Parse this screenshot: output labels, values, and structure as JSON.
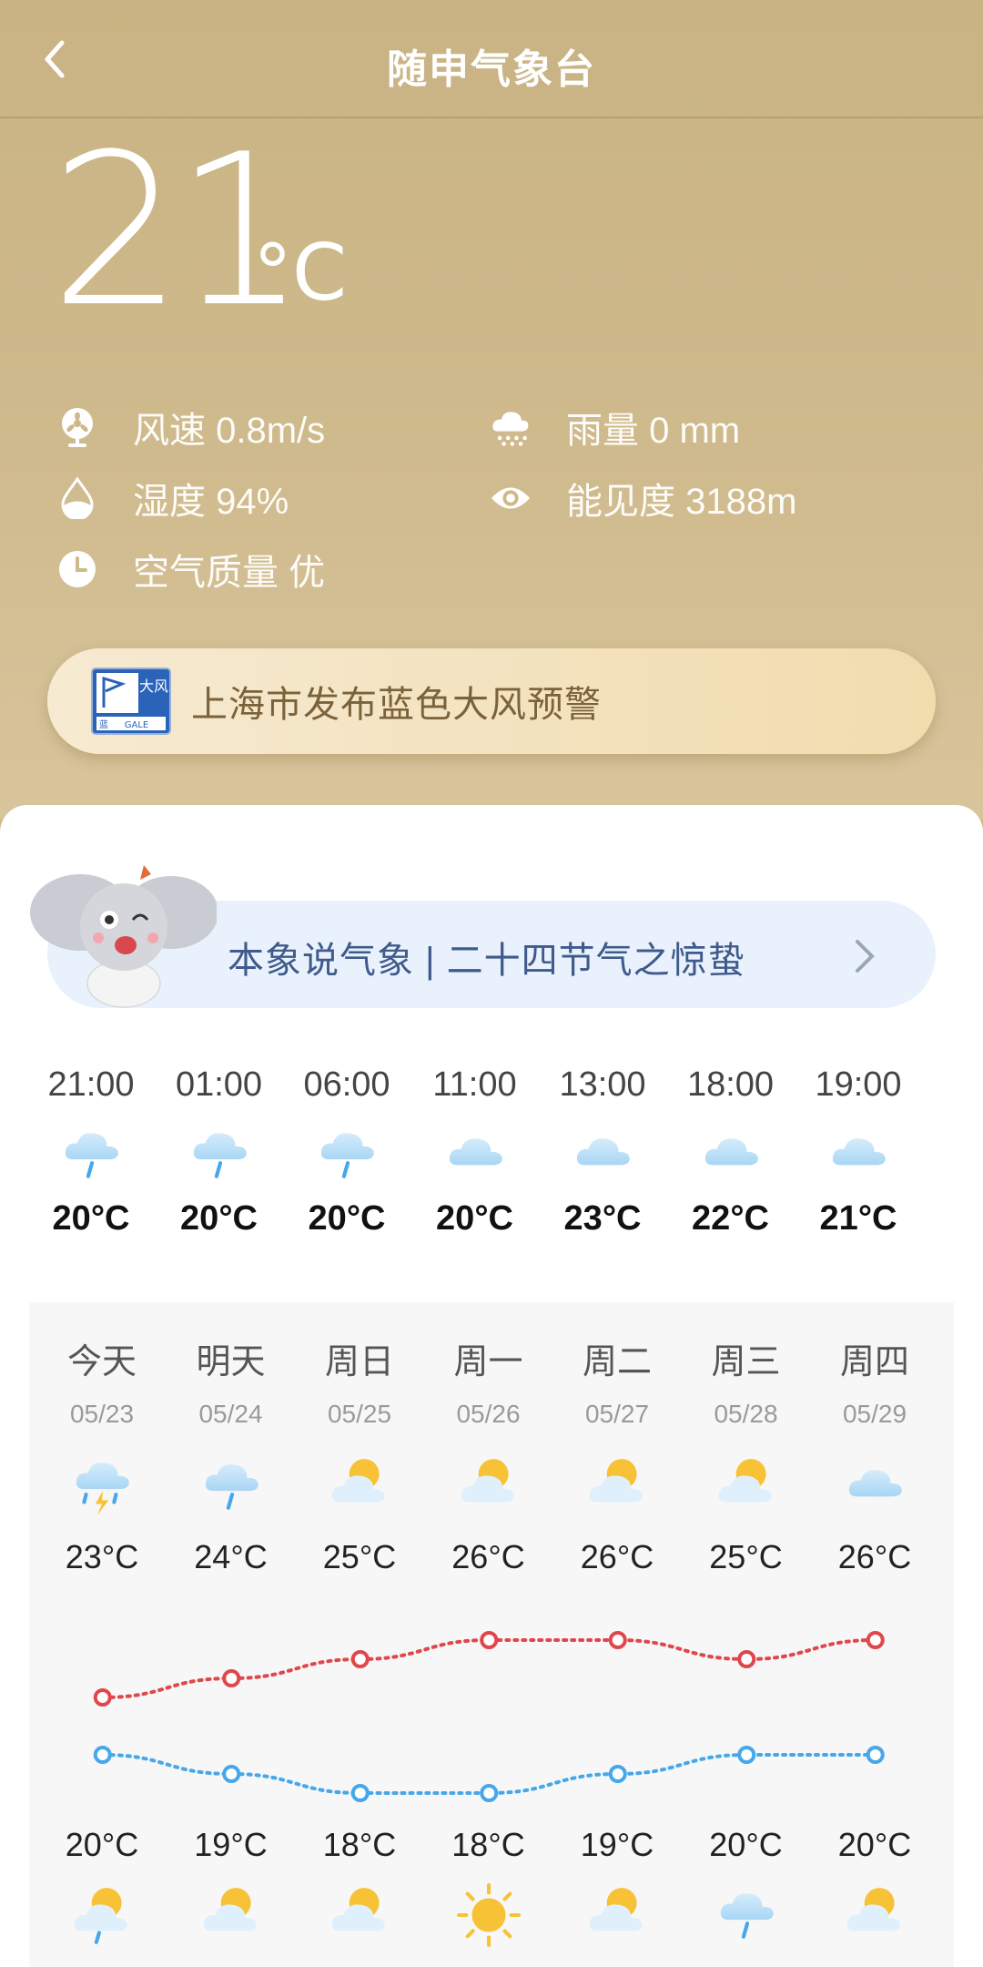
{
  "header": {
    "title": "随申气象台",
    "back_label": "返回"
  },
  "current": {
    "temperature": "21",
    "unit": "°C",
    "wind": "风速 0.8m/s",
    "rain": "雨量 0 mm",
    "humidity": "湿度 94%",
    "visibility": "能见度 3188m",
    "air": "空气质量 优"
  },
  "alert": {
    "text": "上海市发布蓝色大风预警",
    "badge_top": "大风",
    "badge_bottom": "GALE",
    "badge_left": "蓝"
  },
  "knowledge": {
    "text": "本象说气象 | 二十四节气之惊蛰"
  },
  "hourly": [
    {
      "time": "21:00",
      "icon": "rain-icon",
      "temp": "20°C"
    },
    {
      "time": "01:00",
      "icon": "rain-icon",
      "temp": "20°C"
    },
    {
      "time": "06:00",
      "icon": "rain-icon",
      "temp": "20°C"
    },
    {
      "time": "11:00",
      "icon": "cloud-icon",
      "temp": "20°C"
    },
    {
      "time": "13:00",
      "icon": "cloud-icon",
      "temp": "23°C"
    },
    {
      "time": "18:00",
      "icon": "cloud-icon",
      "temp": "22°C"
    },
    {
      "time": "19:00",
      "icon": "cloud-icon",
      "temp": "21°C"
    }
  ],
  "daily": [
    {
      "name": "今天",
      "date": "05/23",
      "day_icon": "thunder-rain-icon",
      "high": "23°C",
      "low": "20°C",
      "night_icon": "partly-cloudy-rain-icon"
    },
    {
      "name": "明天",
      "date": "05/24",
      "day_icon": "rain-icon",
      "high": "24°C",
      "low": "19°C",
      "night_icon": "partly-cloudy-icon"
    },
    {
      "name": "周日",
      "date": "05/25",
      "day_icon": "partly-cloudy-icon",
      "high": "25°C",
      "low": "18°C",
      "night_icon": "partly-cloudy-icon"
    },
    {
      "name": "周一",
      "date": "05/26",
      "day_icon": "partly-cloudy-icon",
      "high": "26°C",
      "low": "18°C",
      "night_icon": "sun-icon"
    },
    {
      "name": "周二",
      "date": "05/27",
      "day_icon": "partly-cloudy-icon",
      "high": "26°C",
      "low": "19°C",
      "night_icon": "partly-cloudy-icon"
    },
    {
      "name": "周三",
      "date": "05/28",
      "day_icon": "partly-cloudy-icon",
      "high": "25°C",
      "low": "20°C",
      "night_icon": "rain-icon"
    },
    {
      "name": "周四",
      "date": "05/29",
      "day_icon": "cloud-icon",
      "high": "26°C",
      "low": "20°C",
      "night_icon": "partly-cloudy-icon"
    }
  ],
  "chart_data": {
    "type": "line",
    "categories": [
      "05/23",
      "05/24",
      "05/25",
      "05/26",
      "05/27",
      "05/28",
      "05/29"
    ],
    "series": [
      {
        "values": [
          23,
          24,
          25,
          26,
          26,
          25,
          26
        ],
        "color": "#e0474c"
      },
      {
        "values": [
          20,
          19,
          18,
          18,
          19,
          20,
          20
        ],
        "color": "#46a7ea"
      }
    ]
  },
  "colors": {
    "accent": "#cfb98a",
    "high": "#e0474c",
    "low": "#46a7ea",
    "knowledge_text": "#3f5a8c"
  }
}
